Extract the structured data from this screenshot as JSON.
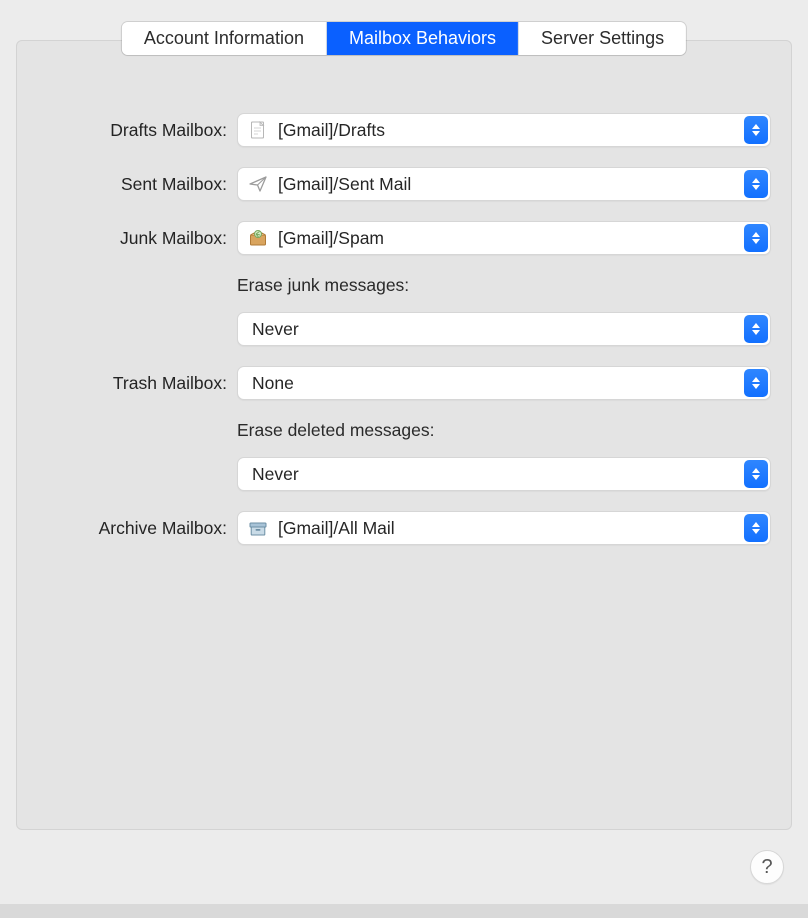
{
  "tabs": {
    "account_info": "Account Information",
    "mailbox_behaviors": "Mailbox Behaviors",
    "server_settings": "Server Settings"
  },
  "labels": {
    "drafts": "Drafts Mailbox:",
    "sent": "Sent Mailbox:",
    "junk": "Junk Mailbox:",
    "erase_junk": "Erase junk messages:",
    "trash": "Trash Mailbox:",
    "erase_deleted": "Erase deleted messages:",
    "archive": "Archive Mailbox:"
  },
  "values": {
    "drafts": "[Gmail]/Drafts",
    "sent": "[Gmail]/Sent Mail",
    "junk": "[Gmail]/Spam",
    "erase_junk": "Never",
    "trash": "None",
    "erase_deleted": "Never",
    "archive": "[Gmail]/All Mail"
  },
  "help": "?"
}
